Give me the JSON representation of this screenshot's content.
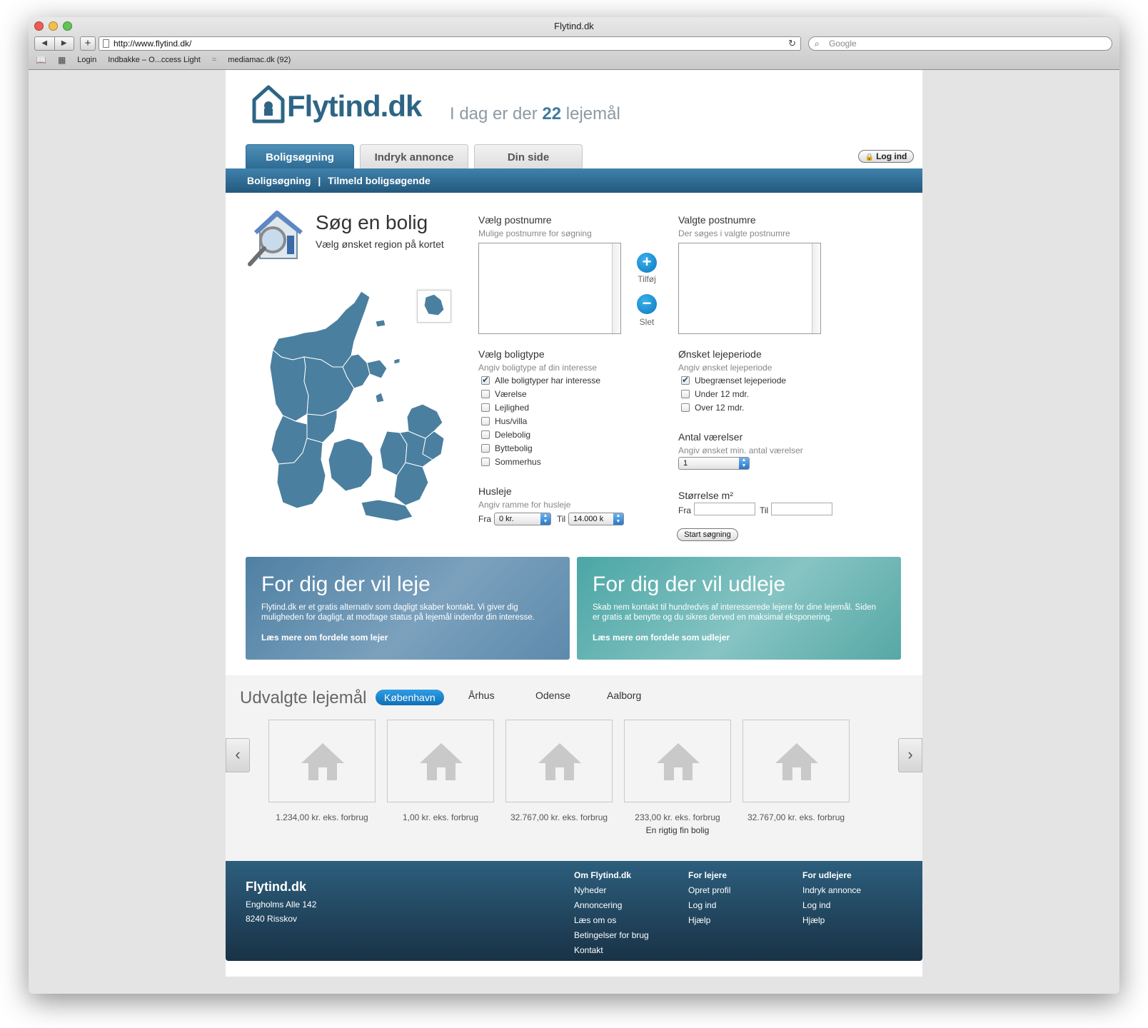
{
  "window": {
    "title": "Flytind.dk"
  },
  "browser": {
    "back": "◀",
    "forward": "▶",
    "add": "+",
    "url": "http://www.flytind.dk/",
    "search_placeholder": "Google",
    "bookmarks": [
      "Login",
      "Indbakke – O...ccess Light",
      "mediamac.dk (92)"
    ],
    "bookmark_separator": "="
  },
  "site": {
    "logo_text": "Flytind.dk",
    "tagline_pre": "I dag er der",
    "tagline_count": "22",
    "tagline_post": "lejemål",
    "tabs": [
      "Boligsøgning",
      "Indryk annonce",
      "Din side"
    ],
    "login": "Log ind",
    "subnav": [
      "Boligsøgning",
      "Tilmeld boligsøgende"
    ],
    "subnav_sep": "|"
  },
  "search": {
    "title": "Søg en bolig",
    "subtitle": "Vælg ønsket region på kortet",
    "postnr": {
      "label": "Vælg postnumre",
      "hint": "Mulige postnumre for søgning"
    },
    "valgte": {
      "label": "Valgte postnumre",
      "hint": "Der søges i valgte postnumre"
    },
    "add": {
      "icon": "+",
      "label": "Tilføj"
    },
    "remove": {
      "icon": "−",
      "label": "Slet"
    },
    "boligtype": {
      "label": "Vælg boligtype",
      "hint": "Angiv boligtype af din interesse",
      "options": [
        {
          "label": "Alle boligtyper har interesse",
          "checked": true
        },
        {
          "label": "Værelse",
          "checked": false
        },
        {
          "label": "Lejlighed",
          "checked": false
        },
        {
          "label": "Hus/villa",
          "checked": false
        },
        {
          "label": "Delebolig",
          "checked": false
        },
        {
          "label": "Byttebolig",
          "checked": false
        },
        {
          "label": "Sommerhus",
          "checked": false
        }
      ]
    },
    "lejeperiode": {
      "label": "Ønsket lejeperiode",
      "hint": "Angiv ønsket lejeperiode",
      "options": [
        {
          "label": "Ubegrænset lejeperiode",
          "checked": true
        },
        {
          "label": "Under 12 mdr.",
          "checked": false
        },
        {
          "label": "Over 12 mdr.",
          "checked": false
        }
      ]
    },
    "vaerelser": {
      "label": "Antal værelser",
      "hint": "Angiv ønsket min. antal værelser",
      "value": "1"
    },
    "husleje": {
      "label": "Husleje",
      "hint": "Angiv ramme for husleje",
      "fra_label": "Fra",
      "fra": "0 kr.",
      "til_label": "Til",
      "til": "14.000 k"
    },
    "stoerrelse": {
      "label": "Størrelse m²",
      "fra_label": "Fra",
      "til_label": "Til",
      "fra": "",
      "til": ""
    },
    "submit": "Start søgning"
  },
  "promos": [
    {
      "title": "For dig der vil leje",
      "text": "Flytind.dk er et gratis alternativ som dagligt skaber kontakt. Vi giver dig muligheden for dagligt, at modtage status på lejemål indenfor din interesse.",
      "link": "Læs mere om fordele som lejer"
    },
    {
      "title": "For dig der vil udleje",
      "text": "Skab nem kontakt til hundredvis af interesserede lejere for dine lejemål. Siden er gratis at benytte og du sikres derved en maksimal eksponering.",
      "link": "Læs mere om fordele som udlejer"
    }
  ],
  "featured": {
    "title": "Udvalgte lejemål",
    "cities": [
      "København",
      "Århus",
      "Odense",
      "Aalborg"
    ],
    "prev": "‹",
    "next": "›",
    "items": [
      {
        "price": "1.234,00 kr. eks. forbrug",
        "desc": ""
      },
      {
        "price": "1,00 kr. eks. forbrug",
        "desc": ""
      },
      {
        "price": "32.767,00 kr. eks. forbrug",
        "desc": ""
      },
      {
        "price": "233,00 kr. eks. forbrug",
        "desc": "En rigtig fin bolig"
      },
      {
        "price": "32.767,00 kr. eks. forbrug",
        "desc": ""
      }
    ]
  },
  "footer": {
    "brand": "Flytind.dk",
    "address1": "Engholms Alle 142",
    "address2": "8240 Risskov",
    "col1": {
      "head": "Om Flytind.dk",
      "links": [
        "Nyheder",
        "Annoncering",
        "Læs om os",
        "Betingelser for brug",
        "Kontakt"
      ]
    },
    "col2": {
      "head": "For lejere",
      "links": [
        "Opret profil",
        "Log ind",
        "Hjælp"
      ]
    },
    "col3": {
      "head": "For udlejere",
      "links": [
        "Indryk annonce",
        "Log ind",
        "Hjælp"
      ]
    }
  },
  "colors": {
    "brand": "#2e6585",
    "tab_active": "#3f82ad",
    "accent_blue": "#0f6fb7",
    "map_fill": "#4a7f9f",
    "footer_top": "#2c5e7d"
  }
}
